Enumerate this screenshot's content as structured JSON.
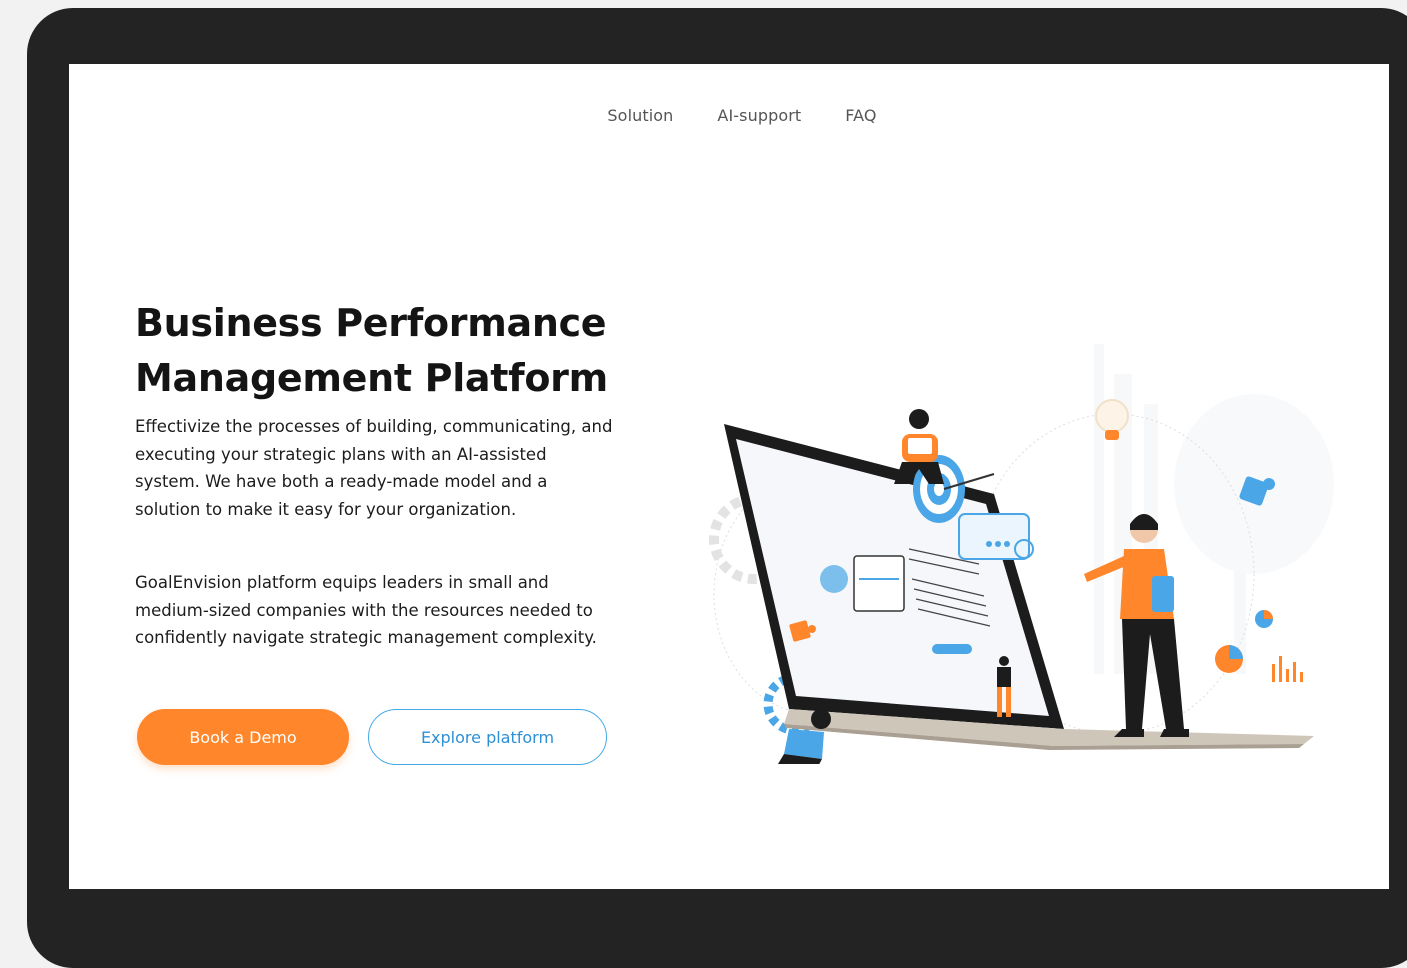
{
  "nav": {
    "items": [
      {
        "label": "Solution"
      },
      {
        "label": "AI-support"
      },
      {
        "label": "FAQ"
      }
    ]
  },
  "hero": {
    "title_line1": "Business Performance",
    "title_line2": "Management Platform",
    "paragraph1": "Effectivize the processes of building, communicating, and executing your strategic plans with an AI-assisted system. We have both a ready-made model and a solution to make it easy for your organization.",
    "paragraph2": "GoalEnvision platform equips leaders in small and medium-sized companies with the resources needed to confidently navigate strategic management complexity."
  },
  "buttons": {
    "primary_label": "Book a Demo",
    "secondary_label": "Explore platform"
  },
  "colors": {
    "accent_orange": "#ff862b",
    "accent_blue": "#45a9e6",
    "device_frame": "#232323"
  }
}
